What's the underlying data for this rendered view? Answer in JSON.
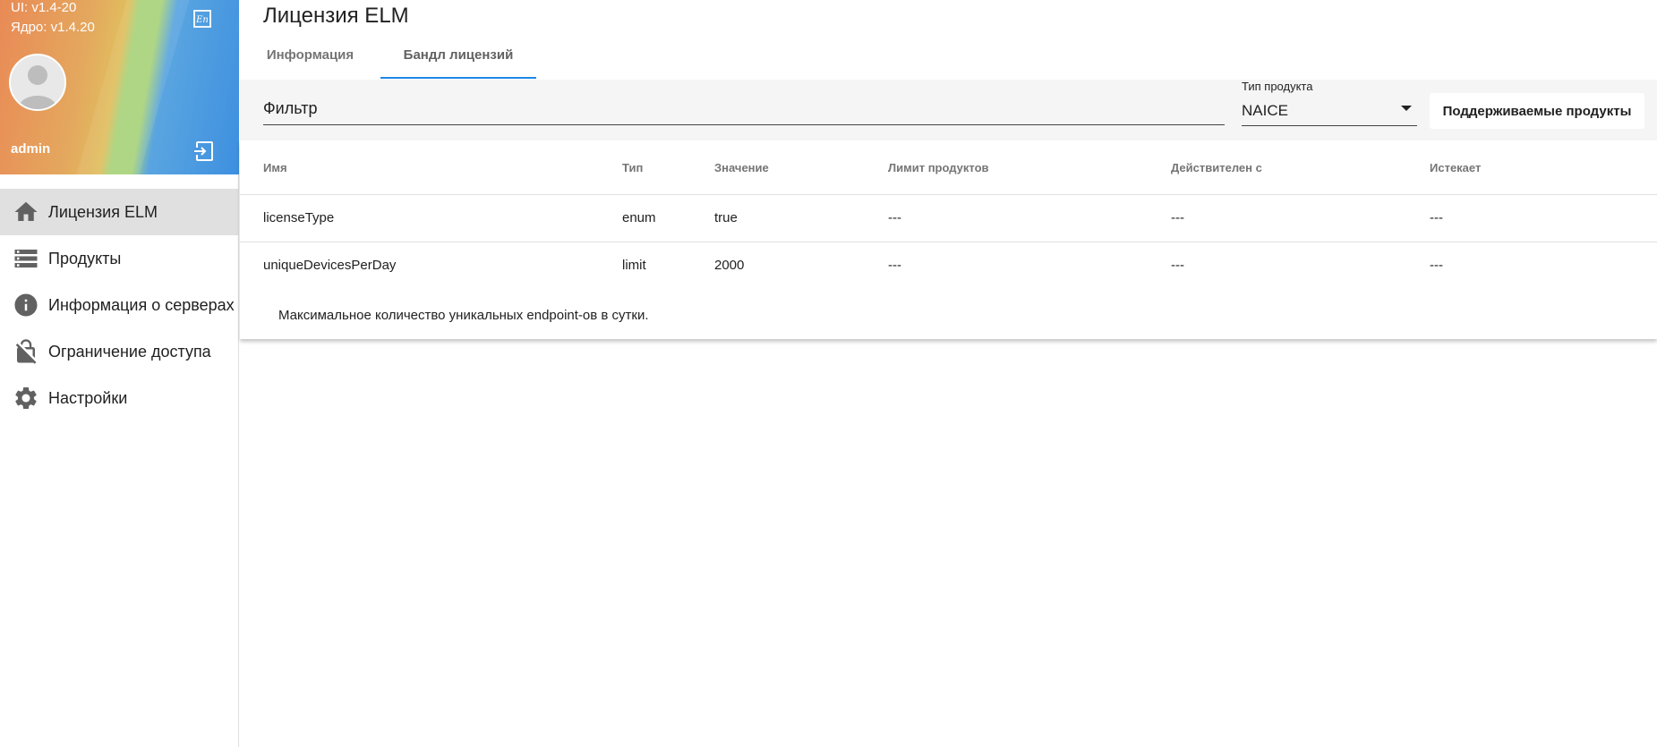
{
  "sidebar": {
    "ui_version": "UI: v1.4-20",
    "core_version": "Ядро: v1.4.20",
    "user_name": "admin",
    "items": [
      {
        "label": "Лицензия ELM",
        "icon": "home-icon",
        "active": true
      },
      {
        "label": "Продукты",
        "icon": "list-icon",
        "active": false
      },
      {
        "label": "Информация о серверах",
        "icon": "info-icon",
        "active": false
      },
      {
        "label": "Ограничение доступа",
        "icon": "lock-off-icon",
        "active": false
      },
      {
        "label": "Настройки",
        "icon": "gear-icon",
        "active": false
      }
    ]
  },
  "main": {
    "title": "Лицензия ELM",
    "tabs": [
      {
        "label": "Информация",
        "active": false
      },
      {
        "label": "Бандл лицензий",
        "active": true
      }
    ],
    "toolbar": {
      "filter_placeholder": "Фильтр",
      "product_type_label": "Тип продукта",
      "product_type_value": "NAICE",
      "supported_button": "Поддерживаемые продукты"
    },
    "table": {
      "columns": [
        "Имя",
        "Тип",
        "Значение",
        "Лимит продуктов",
        "Действителен с",
        "Истекает"
      ],
      "rows": [
        [
          "licenseType",
          "enum",
          "true",
          "---",
          "---",
          "---"
        ],
        [
          "uniqueDevicesPerDay",
          "limit",
          "2000",
          "---",
          "---",
          "---"
        ]
      ],
      "row_description": "Максимальное количество уникальных endpoint-ов в сутки."
    }
  },
  "colors": {
    "accent": "#1e88e5",
    "active_nav_bg": "#e0e0e0",
    "toolbar_bg": "#f5f5f5"
  }
}
